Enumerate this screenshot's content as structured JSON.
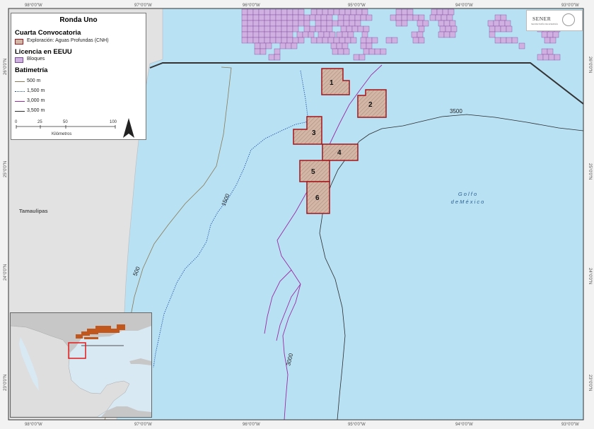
{
  "legend": {
    "title": "Ronda Uno",
    "section_convocatoria": "Cuarta Convocatoria",
    "item_exploracion": "Exploración: Aguas Profundas (CNH)",
    "section_licencia": "Licencia en EEUU",
    "item_bloques": "Bloques",
    "section_batimetria": "Batimetría",
    "depths": [
      "500 m",
      "1,500 m",
      "3,000 m",
      "3,500 m"
    ],
    "scale_ticks": [
      "0",
      "25",
      "50",
      "100"
    ],
    "scale_unit": "Kilómetros",
    "north": "N"
  },
  "logo": {
    "name": "SENER",
    "subtitle": "SECRETARÍA DE ENERGÍA"
  },
  "labels": {
    "state": "Tamaulipas",
    "gulf_line1": "G o l f o",
    "gulf_line2": "d e   M é x i c o",
    "contour_500": "500",
    "contour_1500": "1500",
    "contour_3000": "3000",
    "contour_3500": "3500"
  },
  "blocks": [
    "1",
    "2",
    "3",
    "4",
    "5",
    "6"
  ],
  "coordinates": {
    "top": [
      "98°0'0\"W",
      "97°0'0\"W",
      "96°0'0\"W",
      "95°0'0\"W",
      "94°0'0\"W",
      "93°0'0\"W"
    ],
    "bottom": [
      "98°0'0\"W",
      "97°0'0\"W",
      "96°0'0\"W",
      "95°0'0\"W",
      "94°0'0\"W",
      "93°0'0\"W"
    ],
    "left": [
      "26°0'0\"N",
      "25°0'0\"N",
      "24°0'0\"N",
      "23°0'0\"N"
    ],
    "right": [
      "26°0'0\"N",
      "25°0'0\"N",
      "24°0'0\"N",
      "23°0'0\"N"
    ]
  },
  "colors": {
    "water": "#b8e1f4",
    "land": "#e2e2e2",
    "block_fill": "#d4b6a6",
    "block_border": "#a3161b",
    "us_block_fill": "#cfb0e0",
    "us_block_border": "#7a4a9c",
    "contour_500": "#8a7a55",
    "contour_1500": "#1f4fa0",
    "contour_3000": "#9b2ca1",
    "contour_3500": "#2b2b2b"
  }
}
